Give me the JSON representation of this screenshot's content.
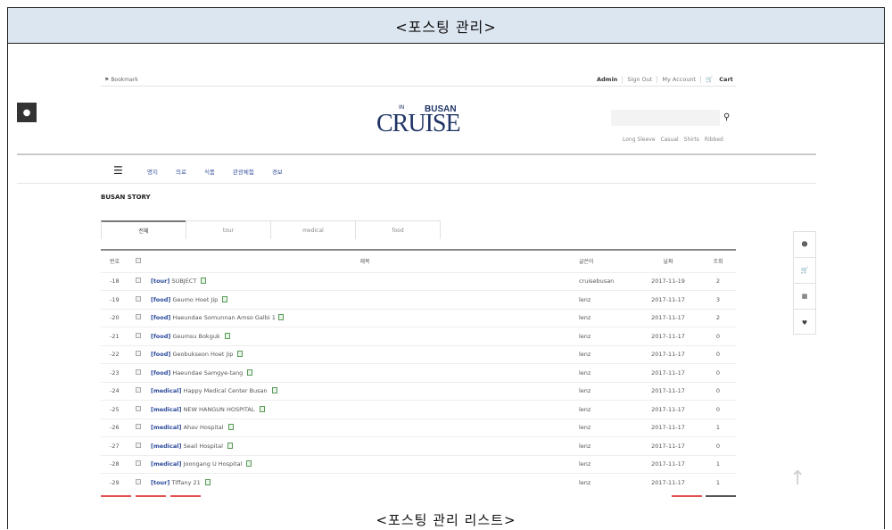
{
  "document": {
    "title": "<포스팅 관리>",
    "caption": "<포스팅 관리 리스트>"
  },
  "header": {
    "bookmark": "Bookmark",
    "top_links": [
      "Admin",
      "Sign Out",
      "My Account",
      "Cart"
    ],
    "logo": {
      "main": "CRUISE",
      "small_top": "IN",
      "busan": "BUSAN"
    },
    "search_icon": "search-icon",
    "quick_links": [
      "Long Sleeve",
      "Casual",
      "Shirts",
      "Ribbed"
    ]
  },
  "nav": {
    "menu_icon": "hamburger-icon",
    "items": [
      "명지",
      "의료",
      "식품",
      "관광체험",
      "경보"
    ]
  },
  "board": {
    "title": "BUSAN STORY",
    "tabs": [
      "전체",
      "tour",
      "medical",
      "food"
    ],
    "active_tab": "전체",
    "columns": {
      "no": "번호",
      "title": "제목",
      "writer": "글쓴이",
      "date": "날짜",
      "views": "조회"
    },
    "rows": [
      {
        "no": "-18",
        "category": "[tour]",
        "title": "SUBJECT",
        "writer": "cruisebusan",
        "date": "2017-11-19",
        "views": "2",
        "comments": ""
      },
      {
        "no": "-19",
        "category": "[food]",
        "title": "Geumo Hoet Jip",
        "writer": "lenz",
        "date": "2017-11-17",
        "views": "3",
        "comments": ""
      },
      {
        "no": "-20",
        "category": "[food]",
        "title": "Haeundae Somunnan Amso Galbi",
        "writer": "lenz",
        "date": "2017-11-17",
        "views": "2",
        "comments": "1"
      },
      {
        "no": "-21",
        "category": "[food]",
        "title": "Geumsu Bokguk",
        "writer": "lenz",
        "date": "2017-11-17",
        "views": "0",
        "comments": ""
      },
      {
        "no": "-22",
        "category": "[food]",
        "title": "Geobukseon Hoet Jip",
        "writer": "lenz",
        "date": "2017-11-17",
        "views": "0",
        "comments": ""
      },
      {
        "no": "-23",
        "category": "[food]",
        "title": "Haeundae Samgye-tang",
        "writer": "lenz",
        "date": "2017-11-17",
        "views": "0",
        "comments": ""
      },
      {
        "no": "-24",
        "category": "[medical]",
        "title": "Happy Medical Center Busan",
        "writer": "lenz",
        "date": "2017-11-17",
        "views": "0",
        "comments": ""
      },
      {
        "no": "-25",
        "category": "[medical]",
        "title": "NEW HANGUN HOSPITAL",
        "writer": "lenz",
        "date": "2017-11-17",
        "views": "0",
        "comments": ""
      },
      {
        "no": "-26",
        "category": "[medical]",
        "title": "Ahav Hospital",
        "writer": "lenz",
        "date": "2017-11-17",
        "views": "1",
        "comments": ""
      },
      {
        "no": "-27",
        "category": "[medical]",
        "title": "Seail Hospital",
        "writer": "lenz",
        "date": "2017-11-17",
        "views": "0",
        "comments": ""
      },
      {
        "no": "-28",
        "category": "[medical]",
        "title": "Joongang U Hospital",
        "writer": "lenz",
        "date": "2017-11-17",
        "views": "1",
        "comments": ""
      },
      {
        "no": "-29",
        "category": "[tour]",
        "title": "Tiffany 21",
        "writer": "lenz",
        "date": "2017-11-17",
        "views": "1",
        "comments": ""
      }
    ]
  },
  "side_icons": [
    "user-icon",
    "cart-icon",
    "list-icon",
    "heart-icon"
  ],
  "colors": {
    "accent_blue": "#2c4a9a",
    "logo_navy": "#1f3566",
    "title_bar": "#dce6f1",
    "red_marker": "#e35050"
  }
}
